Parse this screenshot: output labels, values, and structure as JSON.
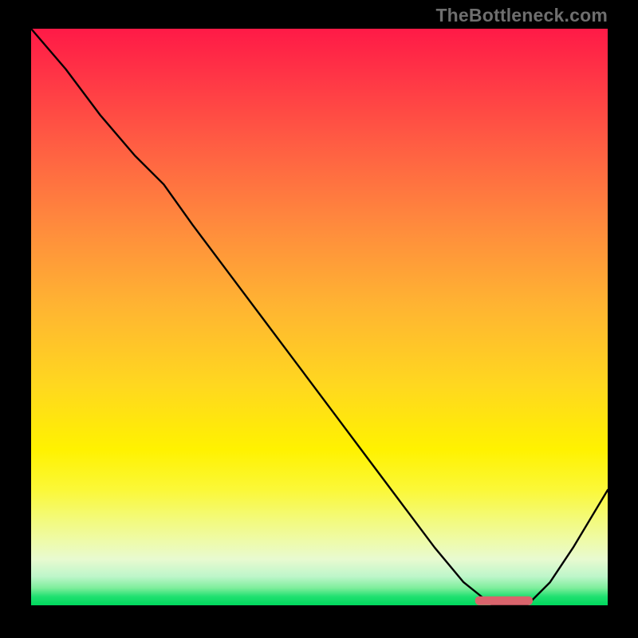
{
  "watermark": "TheBottleneck.com",
  "colors": {
    "curve": "#000000",
    "marker": "#d9646c",
    "gradient_top": "#ff1a47",
    "gradient_mid": "#fff200",
    "gradient_bottom": "#00d85d"
  },
  "chart_data": {
    "type": "line",
    "title": "",
    "xlabel": "",
    "ylabel": "",
    "xlim": [
      0,
      100
    ],
    "ylim": [
      0,
      100
    ],
    "grid": false,
    "legend": false,
    "series": [
      {
        "name": "bottleneck-curve",
        "x": [
          0,
          6,
          12,
          18,
          23,
          28,
          34,
          40,
          46,
          52,
          58,
          64,
          70,
          75,
          80,
          83,
          86,
          90,
          94,
          100
        ],
        "values": [
          100,
          93,
          85,
          78,
          73,
          66,
          58,
          50,
          42,
          34,
          26,
          18,
          10,
          4,
          0,
          0,
          0,
          4,
          10,
          20
        ]
      }
    ],
    "marker": {
      "name": "optimal-range",
      "x_start": 77,
      "x_end": 87,
      "y": 0.8
    }
  }
}
